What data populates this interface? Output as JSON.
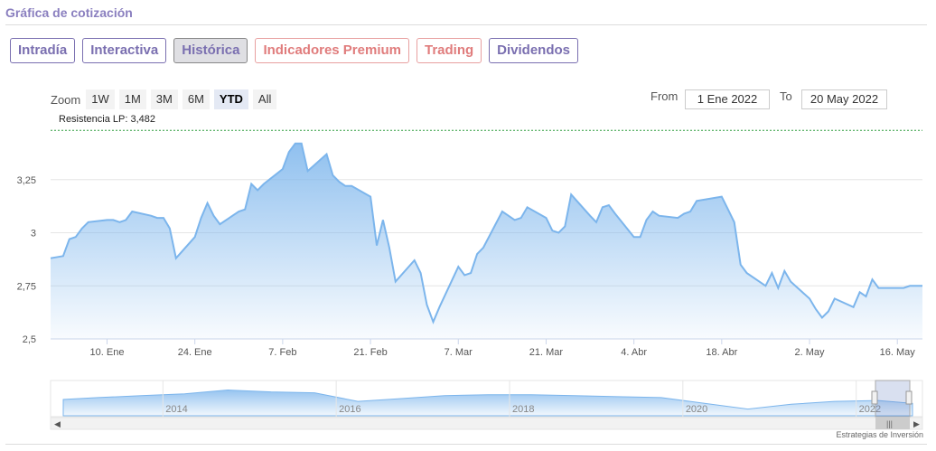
{
  "header": {
    "title": "Gráfica de cotización"
  },
  "tabs": [
    {
      "label": "Intradía",
      "state": "normal"
    },
    {
      "label": "Interactiva",
      "state": "normal"
    },
    {
      "label": "Histórica",
      "state": "active"
    },
    {
      "label": "Indicadores Premium",
      "state": "premium"
    },
    {
      "label": "Trading",
      "state": "premium"
    },
    {
      "label": "Dividendos",
      "state": "normal"
    }
  ],
  "zoom": {
    "label": "Zoom",
    "buttons": [
      "1W",
      "1M",
      "3M",
      "6M",
      "YTD",
      "All"
    ],
    "selected": "YTD"
  },
  "range": {
    "from_label": "From",
    "from_value": "1 Ene 2022",
    "to_label": "To",
    "to_value": "20 May 2022"
  },
  "annotation": {
    "text": "Resistencia LP: 3,482",
    "value": 3.482
  },
  "watermark": "Estrategias de Inversión",
  "colors": {
    "accent": "#7a6fb0",
    "line": "#7cb5ec",
    "premium": "#e07c7c",
    "resistance": "#2e9e3e"
  },
  "chart_data": {
    "type": "area",
    "ylim": [
      2.5,
      3.5
    ],
    "yticks": [
      2.5,
      2.75,
      3,
      3.25
    ],
    "ytick_labels": [
      "2,5",
      "2,75",
      "3",
      "3,25"
    ],
    "xticks": [
      "2022-01-10",
      "2022-01-24",
      "2022-02-07",
      "2022-02-21",
      "2022-03-07",
      "2022-03-21",
      "2022-04-04",
      "2022-04-18",
      "2022-05-02",
      "2022-05-16"
    ],
    "xtick_labels": [
      "10. Ene",
      "24. Ene",
      "7. Feb",
      "21. Feb",
      "7. Mar",
      "21. Mar",
      "4. Abr",
      "18. Abr",
      "2. May",
      "16. May"
    ],
    "x_range": [
      "2022-01-01",
      "2022-05-20"
    ],
    "x": [
      "2022-01-01",
      "2022-01-03",
      "2022-01-04",
      "2022-01-05",
      "2022-01-06",
      "2022-01-07",
      "2022-01-10",
      "2022-01-11",
      "2022-01-12",
      "2022-01-13",
      "2022-01-14",
      "2022-01-17",
      "2022-01-18",
      "2022-01-19",
      "2022-01-20",
      "2022-01-21",
      "2022-01-24",
      "2022-01-25",
      "2022-01-26",
      "2022-01-27",
      "2022-01-28",
      "2022-01-31",
      "2022-02-01",
      "2022-02-02",
      "2022-02-03",
      "2022-02-04",
      "2022-02-07",
      "2022-02-08",
      "2022-02-09",
      "2022-02-10",
      "2022-02-11",
      "2022-02-14",
      "2022-02-15",
      "2022-02-16",
      "2022-02-17",
      "2022-02-18",
      "2022-02-21",
      "2022-02-22",
      "2022-02-23",
      "2022-02-24",
      "2022-02-25",
      "2022-02-28",
      "2022-03-01",
      "2022-03-02",
      "2022-03-03",
      "2022-03-04",
      "2022-03-07",
      "2022-03-08",
      "2022-03-09",
      "2022-03-10",
      "2022-03-11",
      "2022-03-14",
      "2022-03-15",
      "2022-03-16",
      "2022-03-17",
      "2022-03-18",
      "2022-03-21",
      "2022-03-22",
      "2022-03-23",
      "2022-03-24",
      "2022-03-25",
      "2022-03-28",
      "2022-03-29",
      "2022-03-30",
      "2022-03-31",
      "2022-04-01",
      "2022-04-04",
      "2022-04-05",
      "2022-04-06",
      "2022-04-07",
      "2022-04-08",
      "2022-04-11",
      "2022-04-12",
      "2022-04-13",
      "2022-04-14",
      "2022-04-18",
      "2022-04-19",
      "2022-04-20",
      "2022-04-21",
      "2022-04-22",
      "2022-04-25",
      "2022-04-26",
      "2022-04-27",
      "2022-04-28",
      "2022-04-29",
      "2022-05-02",
      "2022-05-03",
      "2022-05-04",
      "2022-05-05",
      "2022-05-06",
      "2022-05-09",
      "2022-05-10",
      "2022-05-11",
      "2022-05-12",
      "2022-05-13",
      "2022-05-16",
      "2022-05-17",
      "2022-05-18",
      "2022-05-19",
      "2022-05-20"
    ],
    "series": [
      {
        "values": [
          2.88,
          2.89,
          2.97,
          2.98,
          3.02,
          3.05,
          3.06,
          3.06,
          3.05,
          3.06,
          3.1,
          3.08,
          3.07,
          3.07,
          3.02,
          2.88,
          2.98,
          3.07,
          3.14,
          3.08,
          3.04,
          3.1,
          3.11,
          3.23,
          3.2,
          3.23,
          3.3,
          3.38,
          3.42,
          3.42,
          3.29,
          3.37,
          3.27,
          3.24,
          3.22,
          3.22,
          3.17,
          2.94,
          3.06,
          2.93,
          2.77,
          2.87,
          2.81,
          2.66,
          2.58,
          2.65,
          2.84,
          2.8,
          2.81,
          2.9,
          2.93,
          3.1,
          3.08,
          3.06,
          3.07,
          3.12,
          3.07,
          3.01,
          3.0,
          3.03,
          3.18,
          3.08,
          3.05,
          3.12,
          3.13,
          3.09,
          2.98,
          2.98,
          3.06,
          3.1,
          3.08,
          3.07,
          3.09,
          3.1,
          3.15,
          3.17,
          3.11,
          3.05,
          2.85,
          2.81,
          2.75,
          2.81,
          2.74,
          2.82,
          2.77,
          2.69,
          2.64,
          2.6,
          2.63,
          2.69,
          2.65,
          2.72,
          2.7,
          2.78,
          2.74,
          2.74,
          2.74,
          2.75,
          2.75,
          2.75
        ]
      }
    ],
    "navigator": {
      "xtick_labels": [
        "2014",
        "2016",
        "2018",
        "2020",
        "2022"
      ],
      "x": [
        2012.6,
        2013.0,
        2013.5,
        2014.0,
        2014.5,
        2015.0,
        2015.5,
        2016.0,
        2016.5,
        2017.0,
        2017.5,
        2018.0,
        2018.5,
        2019.0,
        2019.5,
        2020.0,
        2020.5,
        2021.0,
        2021.5,
        2022.0,
        2022.4
      ],
      "values": [
        3.2,
        3.4,
        3.6,
        3.8,
        4.2,
        4.0,
        3.9,
        3.0,
        3.3,
        3.6,
        3.7,
        3.7,
        3.6,
        3.5,
        3.4,
        2.8,
        2.2,
        2.7,
        3.0,
        3.1,
        2.8
      ]
    }
  }
}
